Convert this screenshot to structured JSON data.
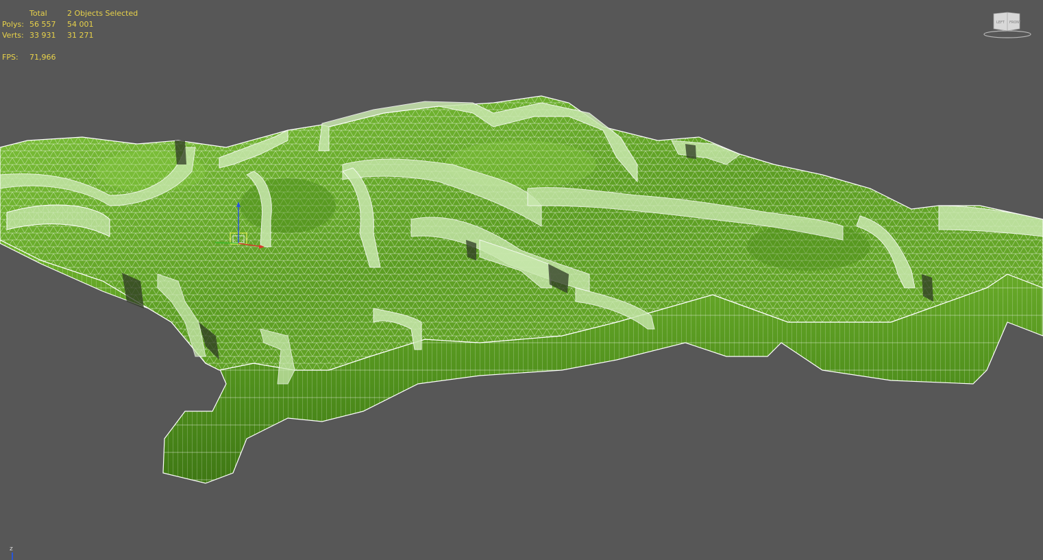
{
  "stats": {
    "header_total": "Total",
    "header_selected": "2 Objects Selected",
    "polys_label": "Polys:",
    "polys_total": "56 557",
    "polys_selected": "54 001",
    "verts_label": "Verts:",
    "verts_total": "33 931",
    "verts_selected": "31 271",
    "fps_label": "FPS:",
    "fps_value": "71,966"
  },
  "viewcube": {
    "left_face": "LEFT",
    "front_face": "FRONT"
  },
  "axis": {
    "z_label": "z"
  },
  "colors": {
    "viewport_bg": "#575757",
    "stats_text": "#e8d24a",
    "terrain_top": "#5fa024",
    "terrain_side": "#4e8a1c",
    "wall": "#c9e8ae",
    "wire": "#ffffff"
  }
}
